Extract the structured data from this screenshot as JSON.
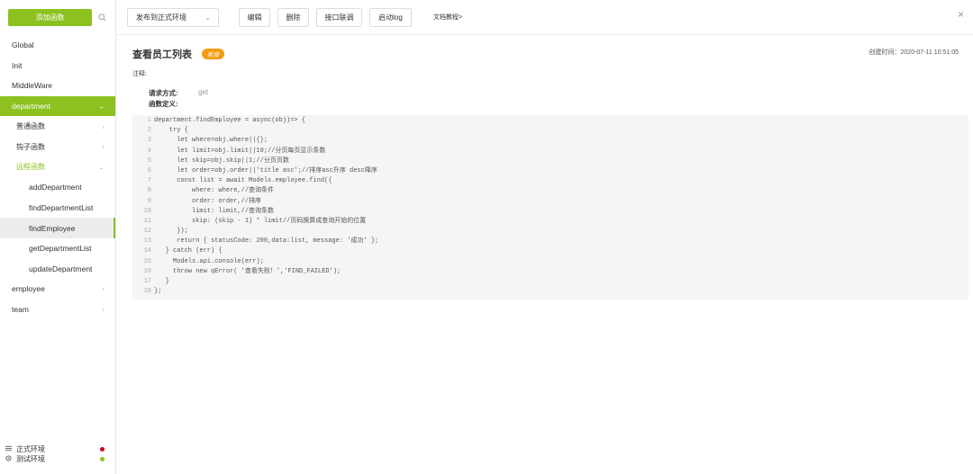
{
  "sidebar": {
    "add_button": "添加函数",
    "items": [
      {
        "label": "Global",
        "level": 1
      },
      {
        "label": "Init",
        "level": 1
      },
      {
        "label": "MiddleWare",
        "level": 1
      },
      {
        "label": "department",
        "level": 1
      },
      {
        "label": "普通函数",
        "level": 2
      },
      {
        "label": "钩子函数",
        "level": 2
      },
      {
        "label": "远程函数",
        "level": 2
      },
      {
        "label": "addDepartment",
        "level": 3
      },
      {
        "label": "findDepartmentList",
        "level": 3
      },
      {
        "label": "findEmployee",
        "level": 3
      },
      {
        "label": "getDepartmentList",
        "level": 3
      },
      {
        "label": "updateDepartment",
        "level": 3
      },
      {
        "label": "employee",
        "level": 1
      },
      {
        "label": "team",
        "level": 1
      }
    ],
    "env": {
      "prod": "正式环境",
      "test": "测试环境",
      "prod_color": "#d0021b",
      "test_color": "#8cc11f"
    }
  },
  "toolbar": {
    "select_value": "发布到正式环境",
    "edit": "编辑",
    "delete": "删除",
    "debug": "接口联调",
    "log": "启动log",
    "doc": "文档教程>"
  },
  "main": {
    "title": "查看员工列表",
    "badge": "新增",
    "created": "创建时间：2020-07-11 10:51:05",
    "note": "注释:",
    "method_label": "请求方式:",
    "method_value": "get",
    "def_label": "函数定义:"
  },
  "code": {
    "lines": [
      {
        "n": "1",
        "text": "department.findEmployee = async(obj)=> {"
      },
      {
        "n": "2",
        "text": "    try {"
      },
      {
        "n": "3",
        "text": "      let where=obj.where||{};"
      },
      {
        "n": "4",
        "text": "      let limit=obj.limit||10;//分页每页显示条数"
      },
      {
        "n": "5",
        "text": "      let skip=obj.skip||1;//分页页数"
      },
      {
        "n": "6",
        "text": "      let order=obj.order||'title asc';//排序asc升序 desc降序"
      },
      {
        "n": "7",
        "text": "      const list = await Models.employee.find({"
      },
      {
        "n": "8",
        "text": "          where: where,//查询条件"
      },
      {
        "n": "9",
        "text": "          order: order,//排序"
      },
      {
        "n": "10",
        "text": "          limit: limit,//查询条数"
      },
      {
        "n": "11",
        "text": "          skip: (skip - 1) * limit//页码换算成查询开始的位置"
      },
      {
        "n": "12",
        "text": "      });"
      },
      {
        "n": "13",
        "text": "      return { statusCode: 200,data:list, message: '成功' };"
      },
      {
        "n": "14",
        "text": "   } catch (err) {"
      },
      {
        "n": "15",
        "text": "     Models.api.console(err);"
      },
      {
        "n": "16",
        "text": "     throw new qError( '查看失败！','FIND_FAILED');"
      },
      {
        "n": "17",
        "text": "   }"
      },
      {
        "n": "18",
        "text": "};"
      }
    ]
  },
  "colors": {
    "accent": "#8cc11f",
    "badge": "#f39c12"
  }
}
